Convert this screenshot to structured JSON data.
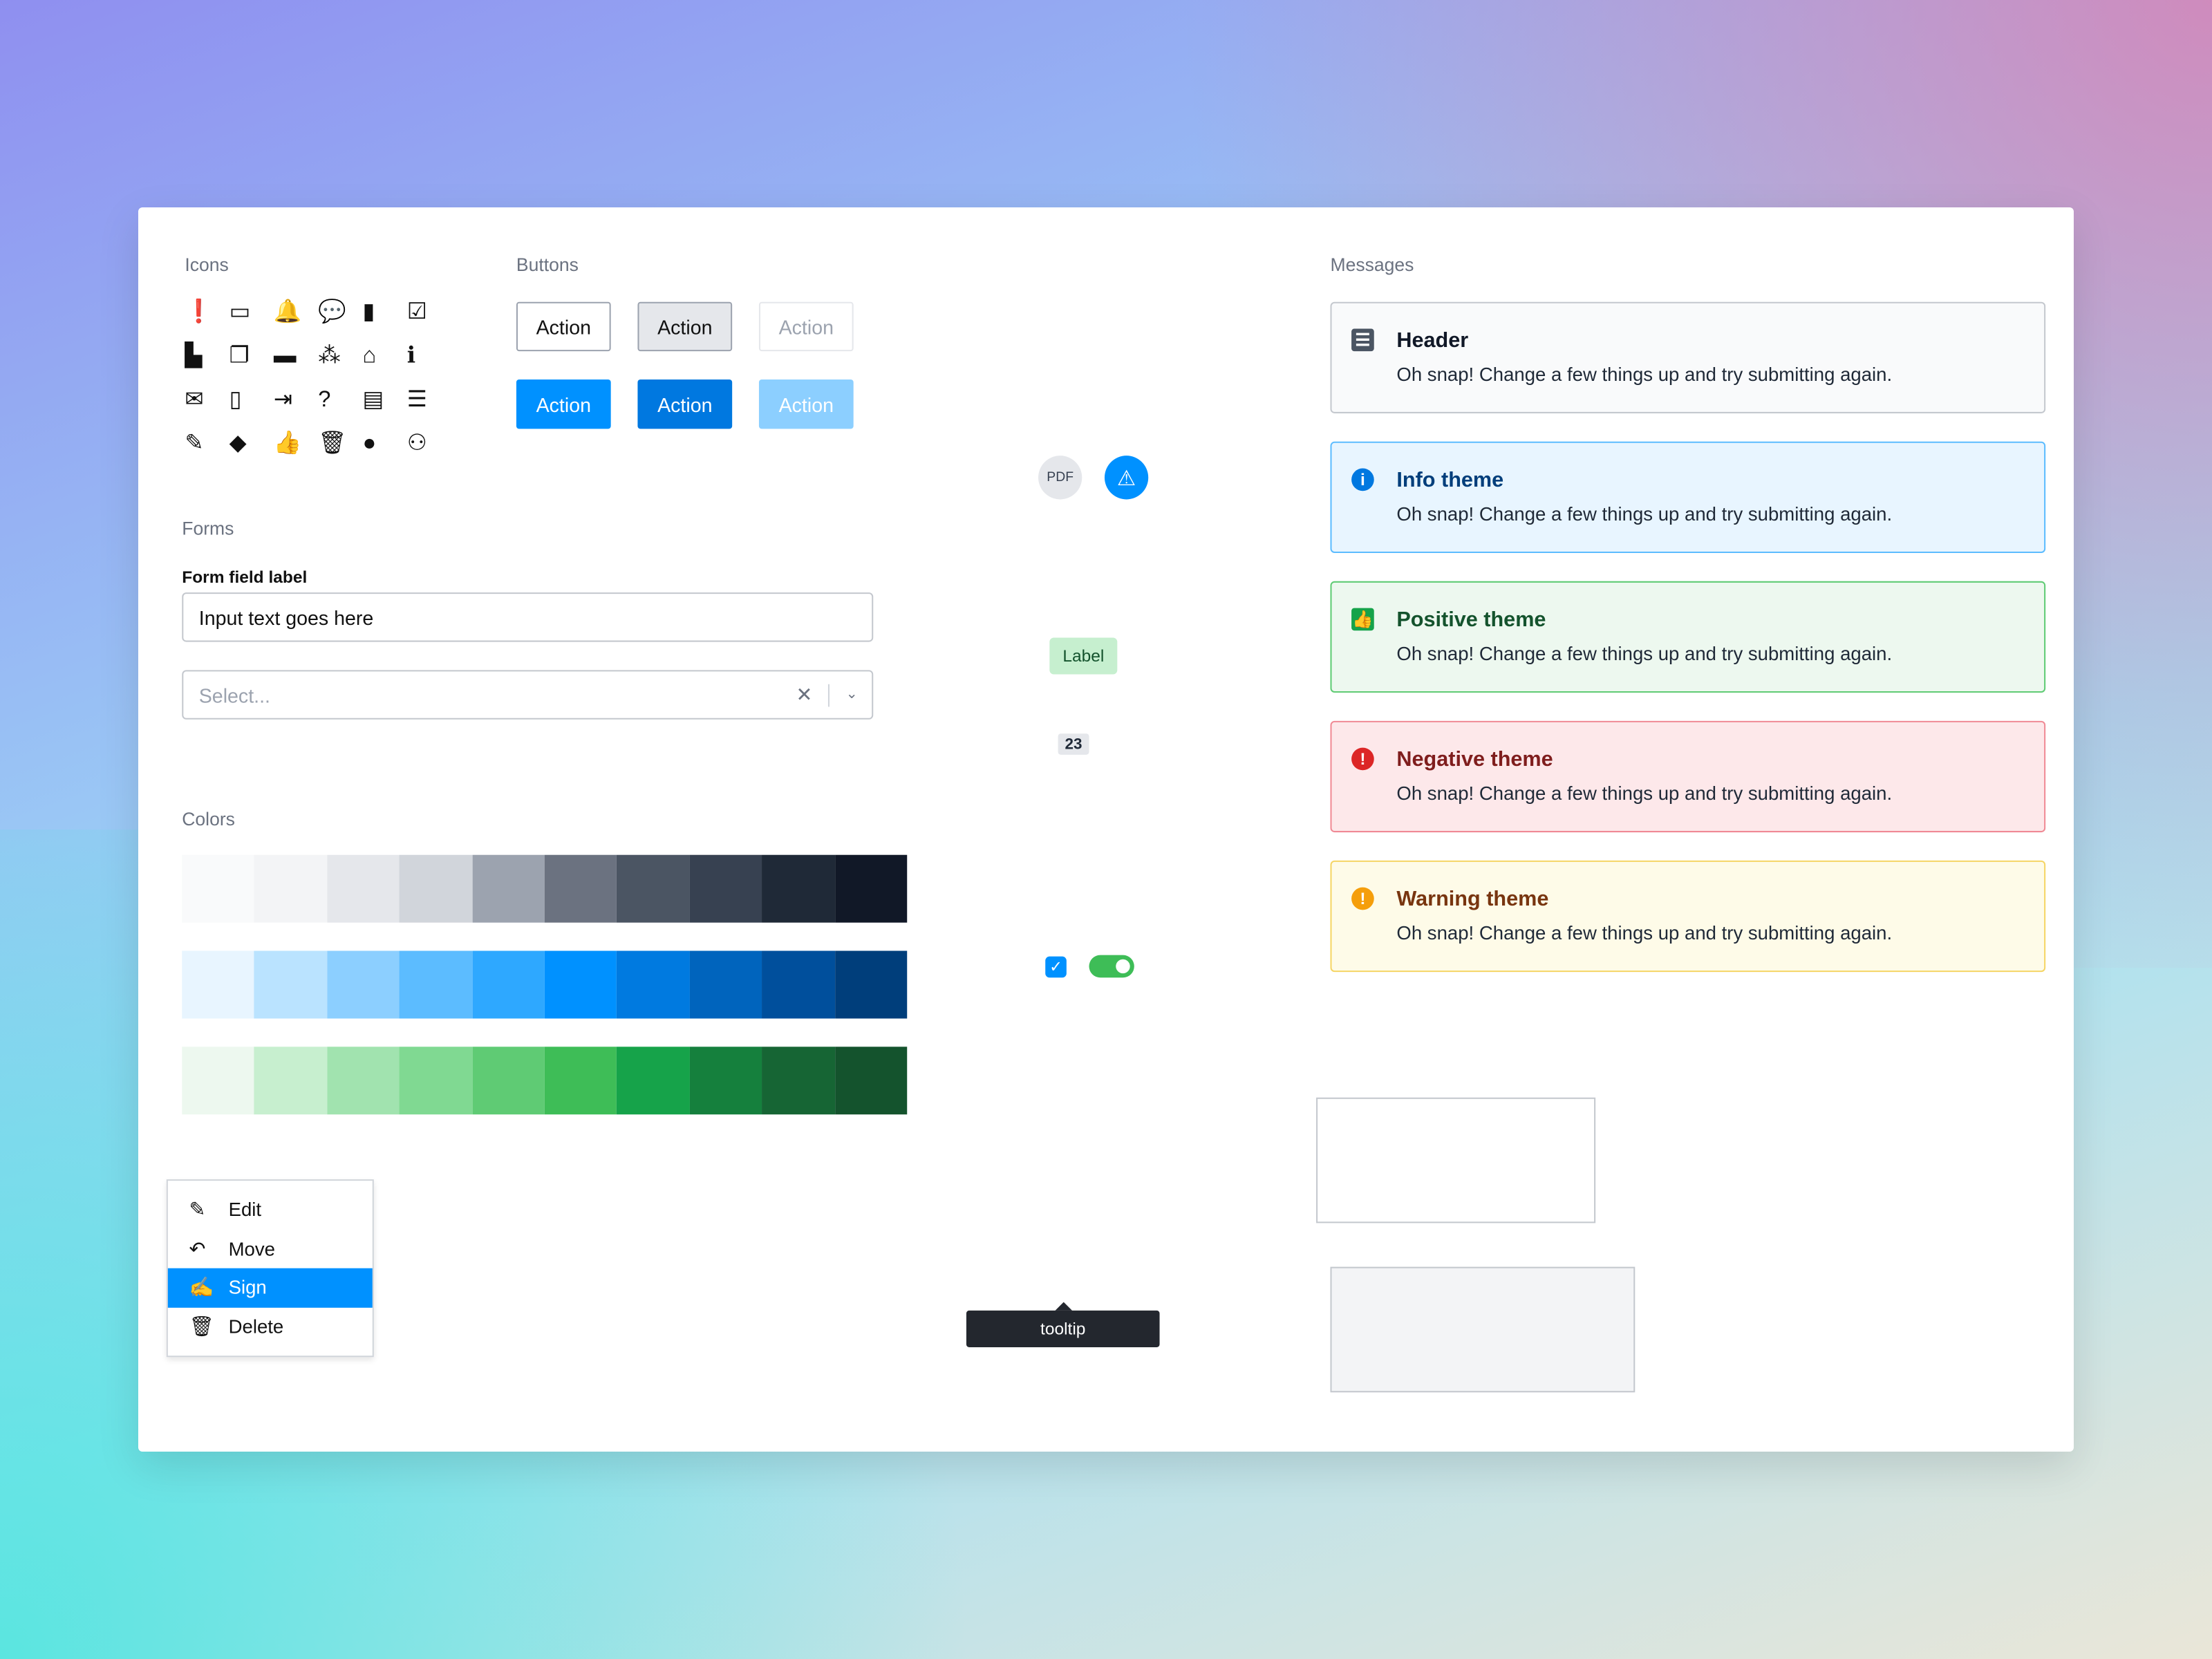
{
  "sections": {
    "icons": "Icons",
    "buttons": "Buttons",
    "forms": "Forms",
    "colors": "Colors",
    "messages": "Messages"
  },
  "icons": [
    "alert-circle",
    "archive",
    "bell",
    "chat-bubbles",
    "clipboard",
    "clipboard-check",
    "file",
    "copy",
    "folder",
    "users-group",
    "home",
    "info",
    "mail",
    "database",
    "sign-in",
    "help",
    "document",
    "contact-list",
    "sign-pen",
    "tag",
    "thumbs-up",
    "trash",
    "user",
    "users"
  ],
  "buttons": {
    "row1": [
      "Action",
      "Action",
      "Action"
    ],
    "row2": [
      "Action",
      "Action",
      "Action"
    ]
  },
  "form": {
    "label": "Form field label",
    "input_value": "Input text goes here",
    "select_placeholder": "Select..."
  },
  "avatar": {
    "pdf": "PDF"
  },
  "label_badge": "Label",
  "count_badge": "23",
  "checkbox_checked": true,
  "toggle_on": true,
  "tooltip": "tooltip",
  "colors": {
    "gray": [
      "#f9fafb",
      "#f3f4f6",
      "#e5e7eb",
      "#d1d5db",
      "#9ca3af",
      "#6b7280",
      "#4b5563",
      "#374151",
      "#1f2937",
      "#111827"
    ],
    "blue": [
      "#e8f5ff",
      "#bae3ff",
      "#8ccfff",
      "#5cbcff",
      "#2ea8ff",
      "#0091ff",
      "#007ae0",
      "#0064bd",
      "#004f9c",
      "#003e7b"
    ],
    "green": [
      "#edf8ef",
      "#c7efcf",
      "#a1e3af",
      "#80d992",
      "#5fcb74",
      "#3ebd57",
      "#16a34a",
      "#15803d",
      "#166534",
      "#14532d"
    ]
  },
  "messages": [
    {
      "title": "Header",
      "body": "Oh snap! Change a few things up and try submitting again."
    },
    {
      "title": "Info theme",
      "body": "Oh snap! Change a few things up and try submitting again."
    },
    {
      "title": "Positive theme",
      "body": "Oh snap! Change a few things up and try submitting again."
    },
    {
      "title": "Negative theme",
      "body": "Oh snap! Change a few things up and try submitting again."
    },
    {
      "title": "Warning theme",
      "body": "Oh snap! Change a few things up and try submitting again."
    }
  ],
  "menu": [
    {
      "label": "Edit"
    },
    {
      "label": "Move"
    },
    {
      "label": "Sign"
    },
    {
      "label": "Delete"
    }
  ]
}
